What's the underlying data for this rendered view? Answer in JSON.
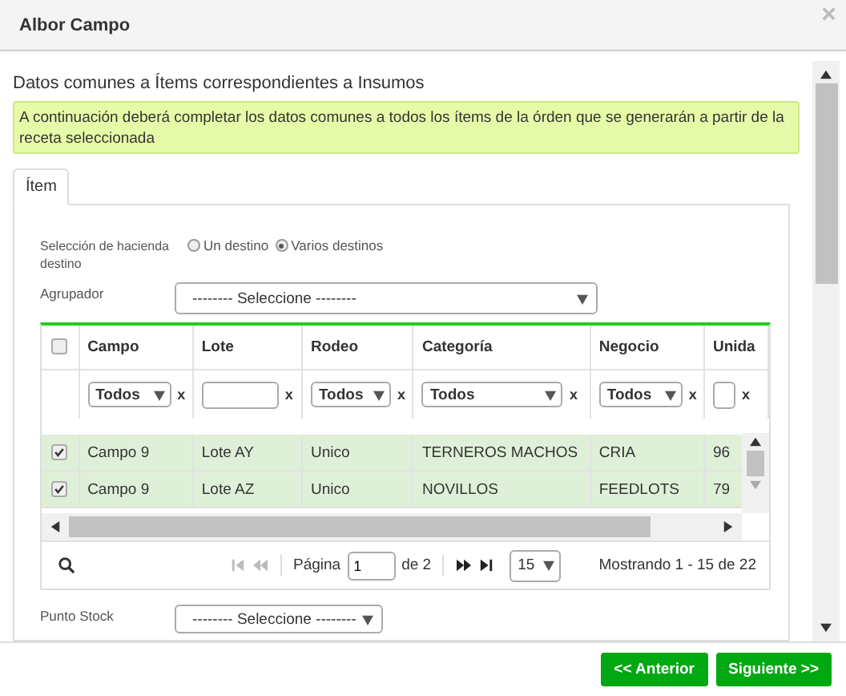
{
  "window": {
    "title": "Albor Campo",
    "close": "×"
  },
  "heading": "Datos comunes a Ítems correspondientes a Insumos",
  "notice": "A continuación deberá completar los datos comunes a todos los ítems de la órden que se generarán a partir de la receta seleccionada",
  "tabs": [
    {
      "label": "Ítem",
      "selected": true
    }
  ],
  "hacienda": {
    "label": "Selección de hacienda destino",
    "options": [
      {
        "label": "Un destino",
        "selected": false
      },
      {
        "label": "Varios destinos",
        "selected": true
      }
    ]
  },
  "agrupador": {
    "label": "Agrupador",
    "value": "-------- Seleccione --------"
  },
  "grid": {
    "header_checked": false,
    "columns": [
      {
        "label": "Campo",
        "filter": {
          "kind": "select",
          "value": "Todos"
        },
        "clear": "x"
      },
      {
        "label": "Lote",
        "filter": {
          "kind": "input"
        },
        "clear": "x"
      },
      {
        "label": "Rodeo",
        "filter": {
          "kind": "select",
          "value": "Todos"
        },
        "clear": "x"
      },
      {
        "label": "Categoría",
        "filter": {
          "kind": "select",
          "value": "Todos"
        },
        "clear": "x"
      },
      {
        "label": "Negocio",
        "filter": {
          "kind": "select",
          "value": "Todos"
        },
        "clear": "x"
      },
      {
        "label": "Unida",
        "filter": {
          "kind": "input"
        },
        "clear": "x"
      }
    ],
    "rows": [
      {
        "checked": true,
        "selected": true,
        "cells": [
          "Campo 9",
          "Lote AY",
          "Unico",
          "TERNEROS MACHOS",
          "CRIA",
          "96"
        ]
      },
      {
        "checked": true,
        "selected": true,
        "cells": [
          "Campo 9",
          "Lote AZ",
          "Unico",
          "NOVILLOS",
          "FEEDLOTS",
          "79"
        ]
      }
    ],
    "pager": {
      "page_label": "Página",
      "page": "1",
      "of": "de 2",
      "page_size": "15",
      "summary": "Mostrando 1 - 15 de 22",
      "first_disabled": true,
      "prev_disabled": true,
      "next_disabled": false,
      "last_disabled": false
    }
  },
  "punto_stock": {
    "label": "Punto Stock",
    "value": "-------- Seleccione --------"
  },
  "buttons": [
    {
      "label": "<< Anterior"
    },
    {
      "label": "Siguiente >>"
    }
  ]
}
